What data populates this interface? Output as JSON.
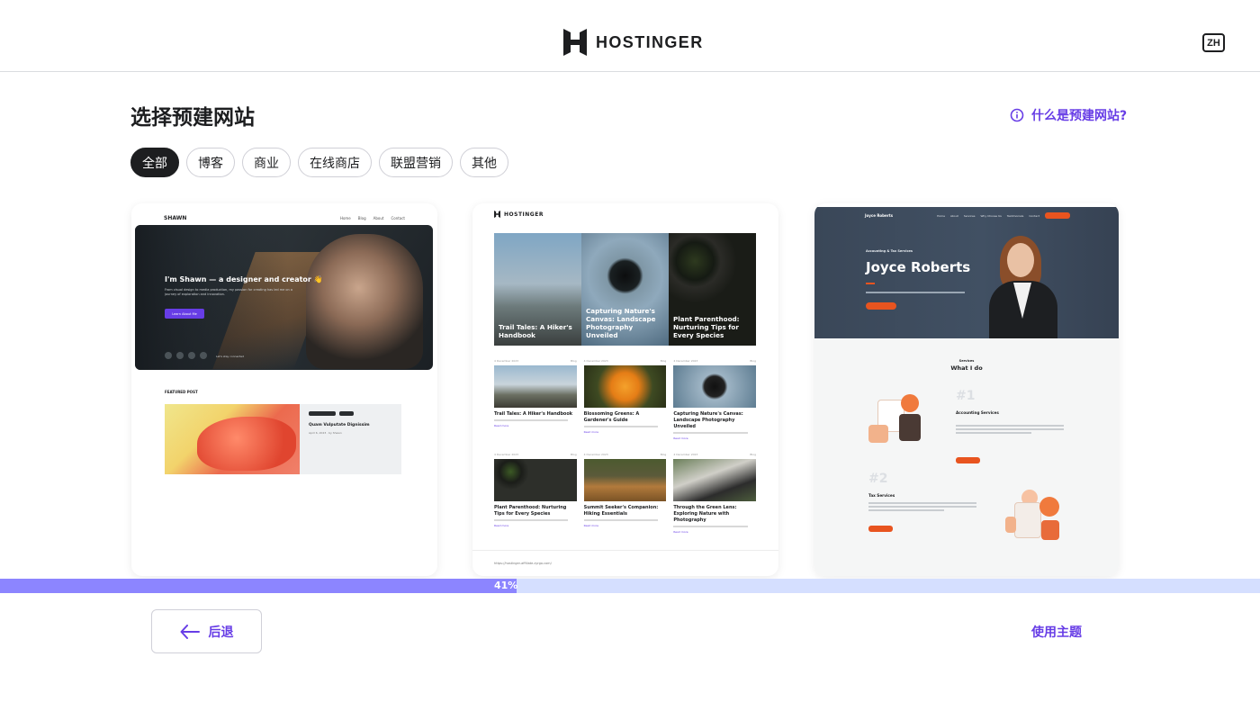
{
  "header": {
    "logo_text": "HOSTINGER",
    "language": "ZH"
  },
  "page": {
    "title": "选择预建网站",
    "help_link": "什么是预建网站?"
  },
  "filters": [
    {
      "label": "全部",
      "active": true
    },
    {
      "label": "博客",
      "active": false
    },
    {
      "label": "商业",
      "active": false
    },
    {
      "label": "在线商店",
      "active": false
    },
    {
      "label": "联盟营销",
      "active": false
    },
    {
      "label": "其他",
      "active": false
    }
  ],
  "templates": {
    "shawn": {
      "brand": "SHAWN",
      "nav": [
        "Home",
        "Blog",
        "About",
        "Contact"
      ],
      "hero_heading": "I'm Shawn — a designer and creator 👋",
      "hero_text": "From visual design to media production, my passion for creating has led me on a journey of exploration and innovation.",
      "hero_button": "Learn About Me",
      "social_caption": "Let's stay connected",
      "featured_label": "FEATURED POST",
      "post_title": "Quam Vulputate Dignissim",
      "post_date": "April 6, 2023 · by Shawn"
    },
    "blog": {
      "brand": "HOSTINGER",
      "hero_tiles": [
        {
          "caption": "Trail Tales: A Hiker's Handbook",
          "style": "t-hiker"
        },
        {
          "caption": "Capturing Nature's Canvas: Landscape Photography Unveiled",
          "style": "t-lens"
        },
        {
          "caption": "Plant Parenthood: Nurturing Tips for Every Species",
          "style": "t-plants"
        }
      ],
      "posts": [
        {
          "date": "4 December 2023",
          "cat": "Blog",
          "title": "Trail Tales: A Hiker's Handbook",
          "style": "i-mount"
        },
        {
          "date": "4 December 2023",
          "cat": "Blog",
          "title": "Blossoming Greens: A Gardener's Guide",
          "style": "i-flowers"
        },
        {
          "date": "4 December 2023",
          "cat": "Blog",
          "title": "Capturing Nature's Canvas: Landscape Photography Unveiled",
          "style": "i-lens"
        },
        {
          "date": "4 December 2023",
          "cat": "Blog",
          "title": "Plant Parenthood: Nurturing Tips for Every Species",
          "style": "i-seed"
        },
        {
          "date": "4 December 2023",
          "cat": "Blog",
          "title": "Summit Seeker's Companion: Hiking Essentials",
          "style": "i-boots"
        },
        {
          "date": "4 December 2023",
          "cat": "Blog",
          "title": "Through the Green Lens: Exploring Nature with Photography",
          "style": "i-camera"
        }
      ],
      "read_more": "Read more",
      "footer_url": "https://hostinger-affiliate.zyrgo.com/"
    },
    "joyce": {
      "brand": "Joyce Roberts",
      "nav": [
        "Home",
        "About",
        "Services",
        "Why Choose Us",
        "Testimonials",
        "Contact"
      ],
      "kicker": "Accounting & Tax Services",
      "name": "Joyce Roberts",
      "services_kicker": "Services",
      "services_title": "What I do",
      "services": [
        {
          "num": "#1",
          "name": "Accounting Services"
        },
        {
          "num": "#2",
          "name": "Tax Services"
        }
      ]
    }
  },
  "progress": {
    "value": 0.41,
    "label": "41%"
  },
  "footer": {
    "back_label": "后退",
    "use_theme_label": "使用主题"
  },
  "colors": {
    "accent": "#673de6",
    "progress_track": "#d5dfff",
    "progress_fill": "#8c85ff",
    "dark": "#1d1e20",
    "orange": "#e8541f"
  }
}
